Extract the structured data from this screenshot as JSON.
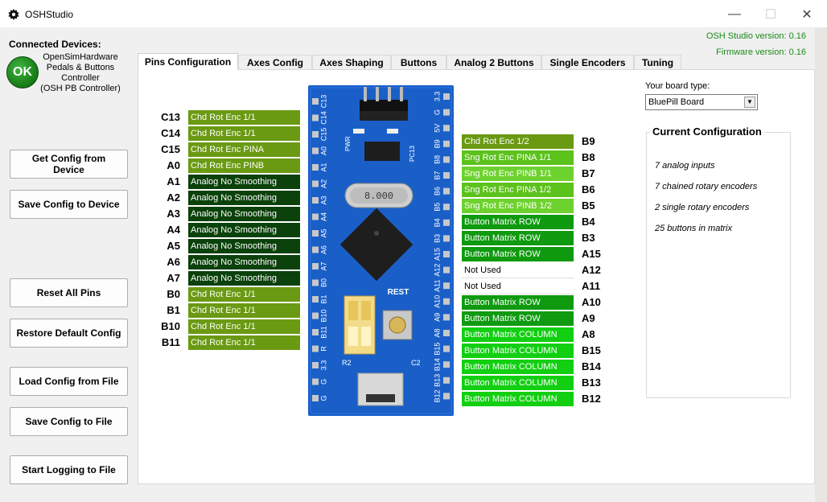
{
  "window": {
    "title": "OSHStudio",
    "minimize": "—",
    "maximize": "☐",
    "close": "✕"
  },
  "versions": {
    "studio": "OSH Studio version: 0.16",
    "firmware": "Firmware version: 0.16"
  },
  "device": {
    "connected_title": "Connected Devices:",
    "status": "OK",
    "name_lines": [
      "OpenSimHardware",
      "Pedals & Buttons",
      "Controller",
      "(OSH PB Controller)"
    ]
  },
  "buttons": {
    "get_config": "Get Config from Device",
    "save_config": "Save Config to Device",
    "reset_pins": "Reset All Pins",
    "restore_default": "Restore Default Config",
    "load_file": "Load Config from File",
    "save_file": "Save Config to File",
    "start_logging": "Start Logging to File"
  },
  "tabs": [
    "Pins Configuration",
    "Axes Config",
    "Axes Shaping",
    "Buttons",
    "Analog 2 Buttons",
    "Single Encoders",
    "Tuning"
  ],
  "colors": {
    "enc_chained": "#6a9a12",
    "analog": "#0b420b",
    "single_enc_a": "#5cc21c",
    "single_enc_b": "#6ed22e",
    "button_row": "#0f9a0f",
    "button_col": "#12cf12",
    "not_used": "#ffffff"
  },
  "left_pins": [
    {
      "pin": "C13",
      "value": "Chd Rot Enc 1/1",
      "color": "#6a9a12"
    },
    {
      "pin": "C14",
      "value": "Chd Rot Enc 1/1",
      "color": "#6a9a12"
    },
    {
      "pin": "C15",
      "value": "Chd Rot Enc PINA",
      "color": "#6a9a12"
    },
    {
      "pin": "A0",
      "value": "Chd Rot Enc PINB",
      "color": "#6a9a12"
    },
    {
      "pin": "A1",
      "value": "Analog No Smoothing",
      "color": "#0b420b"
    },
    {
      "pin": "A2",
      "value": "Analog No Smoothing",
      "color": "#0b420b"
    },
    {
      "pin": "A3",
      "value": "Analog No Smoothing",
      "color": "#0b420b"
    },
    {
      "pin": "A4",
      "value": "Analog No Smoothing",
      "color": "#0b420b"
    },
    {
      "pin": "A5",
      "value": "Analog No Smoothing",
      "color": "#0b420b"
    },
    {
      "pin": "A6",
      "value": "Analog No Smoothing",
      "color": "#0b420b"
    },
    {
      "pin": "A7",
      "value": "Analog No Smoothing",
      "color": "#0b420b"
    },
    {
      "pin": "B0",
      "value": "Chd Rot Enc 1/1",
      "color": "#6a9a12"
    },
    {
      "pin": "B1",
      "value": "Chd Rot Enc 1/1",
      "color": "#6a9a12"
    },
    {
      "pin": "B10",
      "value": "Chd Rot Enc 1/1",
      "color": "#6a9a12"
    },
    {
      "pin": "B11",
      "value": "Chd Rot Enc 1/1",
      "color": "#6a9a12"
    }
  ],
  "right_pins": [
    {
      "pin": "B9",
      "value": "Chd Rot Enc 1/2",
      "color": "#6a9a12"
    },
    {
      "pin": "B8",
      "value": "Sng Rot Enc PINA 1/1",
      "color": "#5cc21c"
    },
    {
      "pin": "B7",
      "value": "Sng Rot Enc PINB 1/1",
      "color": "#6ed22e"
    },
    {
      "pin": "B6",
      "value": "Sng Rot Enc PINA 1/2",
      "color": "#5cc21c"
    },
    {
      "pin": "B5",
      "value": "Sng Rot Enc PINB 1/2",
      "color": "#6ed22e"
    },
    {
      "pin": "B4",
      "value": "Button Matrix ROW",
      "color": "#0f9a0f"
    },
    {
      "pin": "B3",
      "value": "Button Matrix ROW",
      "color": "#0f9a0f"
    },
    {
      "pin": "A15",
      "value": "Button Matrix ROW",
      "color": "#0f9a0f"
    },
    {
      "pin": "A12",
      "value": "Not Used",
      "color": "#ffffff"
    },
    {
      "pin": "A11",
      "value": "Not Used",
      "color": "#ffffff"
    },
    {
      "pin": "A10",
      "value": "Button Matrix ROW",
      "color": "#0f9a0f"
    },
    {
      "pin": "A9",
      "value": "Button Matrix ROW",
      "color": "#0f9a0f"
    },
    {
      "pin": "A8",
      "value": "Button Matrix COLUMN",
      "color": "#12cf12"
    },
    {
      "pin": "B15",
      "value": "Button Matrix COLUMN",
      "color": "#12cf12"
    },
    {
      "pin": "B14",
      "value": "Button Matrix COLUMN",
      "color": "#12cf12"
    },
    {
      "pin": "B13",
      "value": "Button Matrix COLUMN",
      "color": "#12cf12"
    },
    {
      "pin": "B12",
      "value": "Button Matrix COLUMN",
      "color": "#12cf12"
    }
  ],
  "board": {
    "label": "Your board type:",
    "selected": "BluePill Board",
    "left_header": [
      "C13",
      "C14",
      "C15",
      "A0",
      "A1",
      "A2",
      "A3",
      "A4",
      "A5",
      "A6",
      "A7",
      "B0",
      "B1",
      "B10",
      "B11",
      "R",
      "3.3",
      "G",
      "G"
    ],
    "right_header": [
      "3.3",
      "G",
      "5V",
      "B9",
      "B8",
      "B7",
      "B6",
      "B5",
      "B4",
      "B3",
      "A15",
      "A12",
      "A11",
      "A10",
      "A9",
      "A8",
      "B15",
      "B14",
      "B13",
      "B12"
    ],
    "crystal_text": "8.000",
    "rest_text": "REST",
    "pwr_text": "PWR",
    "pc13_text": "PC13",
    "r2_text": "R2",
    "c2_text": "C2"
  },
  "current_config": {
    "title": "Current Configuration",
    "lines": [
      "7 analog inputs",
      "7 chained rotary encoders",
      "2 single rotary encoders",
      "25 buttons in matrix"
    ]
  }
}
